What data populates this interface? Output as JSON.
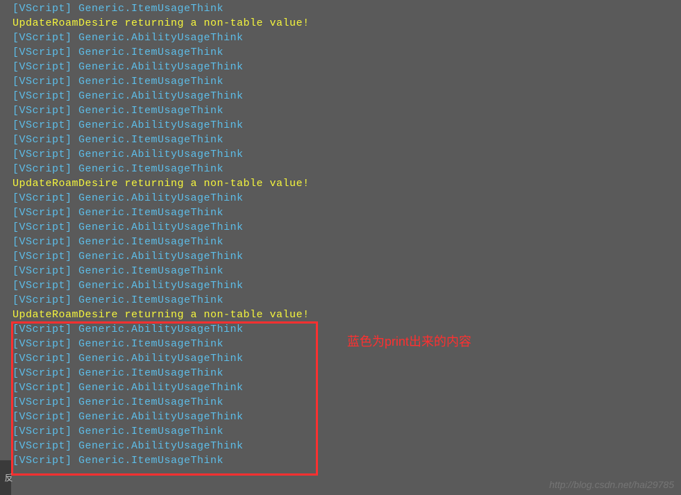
{
  "console_lines": [
    {
      "type": "blue",
      "prefix": "[VScript]",
      "text": "Generic.ItemUsageThink"
    },
    {
      "type": "yellow",
      "prefix": "",
      "text": "UpdateRoamDesire returning a non-table value!"
    },
    {
      "type": "blue",
      "prefix": "[VScript]",
      "text": "Generic.AbilityUsageThink"
    },
    {
      "type": "blue",
      "prefix": "[VScript]",
      "text": "Generic.ItemUsageThink"
    },
    {
      "type": "blue",
      "prefix": "[VScript]",
      "text": "Generic.AbilityUsageThink"
    },
    {
      "type": "blue",
      "prefix": "[VScript]",
      "text": "Generic.ItemUsageThink"
    },
    {
      "type": "blue",
      "prefix": "[VScript]",
      "text": "Generic.AbilityUsageThink"
    },
    {
      "type": "blue",
      "prefix": "[VScript]",
      "text": "Generic.ItemUsageThink"
    },
    {
      "type": "blue",
      "prefix": "[VScript]",
      "text": "Generic.AbilityUsageThink"
    },
    {
      "type": "blue",
      "prefix": "[VScript]",
      "text": "Generic.ItemUsageThink"
    },
    {
      "type": "blue",
      "prefix": "[VScript]",
      "text": "Generic.AbilityUsageThink"
    },
    {
      "type": "blue",
      "prefix": "[VScript]",
      "text": "Generic.ItemUsageThink"
    },
    {
      "type": "yellow",
      "prefix": "",
      "text": "UpdateRoamDesire returning a non-table value!"
    },
    {
      "type": "blue",
      "prefix": "[VScript]",
      "text": "Generic.AbilityUsageThink"
    },
    {
      "type": "blue",
      "prefix": "[VScript]",
      "text": "Generic.ItemUsageThink"
    },
    {
      "type": "blue",
      "prefix": "[VScript]",
      "text": "Generic.AbilityUsageThink"
    },
    {
      "type": "blue",
      "prefix": "[VScript]",
      "text": "Generic.ItemUsageThink"
    },
    {
      "type": "blue",
      "prefix": "[VScript]",
      "text": "Generic.AbilityUsageThink"
    },
    {
      "type": "blue",
      "prefix": "[VScript]",
      "text": "Generic.ItemUsageThink"
    },
    {
      "type": "blue",
      "prefix": "[VScript]",
      "text": "Generic.AbilityUsageThink"
    },
    {
      "type": "blue",
      "prefix": "[VScript]",
      "text": "Generic.ItemUsageThink"
    },
    {
      "type": "yellow",
      "prefix": "",
      "text": "UpdateRoamDesire returning a non-table value!"
    },
    {
      "type": "blue",
      "prefix": "[VScript]",
      "text": "Generic.AbilityUsageThink"
    },
    {
      "type": "blue",
      "prefix": "[VScript]",
      "text": "Generic.ItemUsageThink"
    },
    {
      "type": "blue",
      "prefix": "[VScript]",
      "text": "Generic.AbilityUsageThink"
    },
    {
      "type": "blue",
      "prefix": "[VScript]",
      "text": "Generic.ItemUsageThink"
    },
    {
      "type": "blue",
      "prefix": "[VScript]",
      "text": "Generic.AbilityUsageThink"
    },
    {
      "type": "blue",
      "prefix": "[VScript]",
      "text": "Generic.ItemUsageThink"
    },
    {
      "type": "blue",
      "prefix": "[VScript]",
      "text": "Generic.AbilityUsageThink"
    },
    {
      "type": "blue",
      "prefix": "[VScript]",
      "text": "Generic.ItemUsageThink"
    },
    {
      "type": "blue",
      "prefix": "[VScript]",
      "text": "Generic.AbilityUsageThink"
    },
    {
      "type": "blue",
      "prefix": "[VScript]",
      "text": "Generic.ItemUsageThink"
    }
  ],
  "annotation_text": "蓝色为print出来的内容",
  "watermark_text": "http://blog.csdn.net/hai29785",
  "left_edge_text": "反"
}
